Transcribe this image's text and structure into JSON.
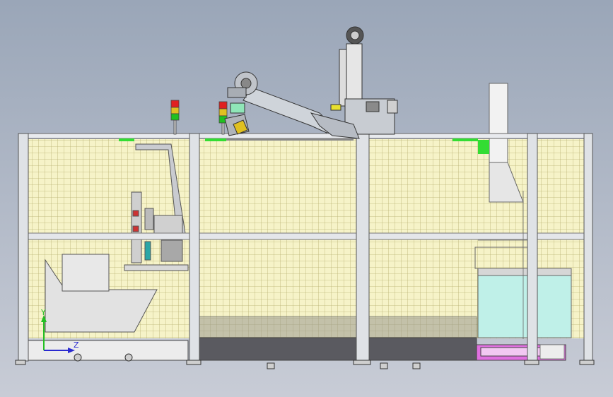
{
  "view": {
    "background_top": "#9aa6b8",
    "background_bottom": "#c8ccd6"
  },
  "triad": {
    "y_label": "Y",
    "z_label": "Z",
    "y_color": "#22c022",
    "z_color": "#2a2ad0"
  },
  "colors": {
    "fence_frame": "#d8dce2",
    "fence_mesh_bg": "#f6f3c8",
    "fence_mesh_line": "#b8b070",
    "beam": "#e4e6ea",
    "green_sensor": "#33dd33",
    "robot_body": "#b8bec8",
    "robot_joint": "#8fe6b8",
    "stack_light_red": "#e02020",
    "stack_light_yellow": "#e0c020",
    "stack_light_green": "#20c020",
    "base_dark": "#5a5a60",
    "magenta_part": "#e070e0",
    "cyan_tank": "#bff0e8"
  }
}
